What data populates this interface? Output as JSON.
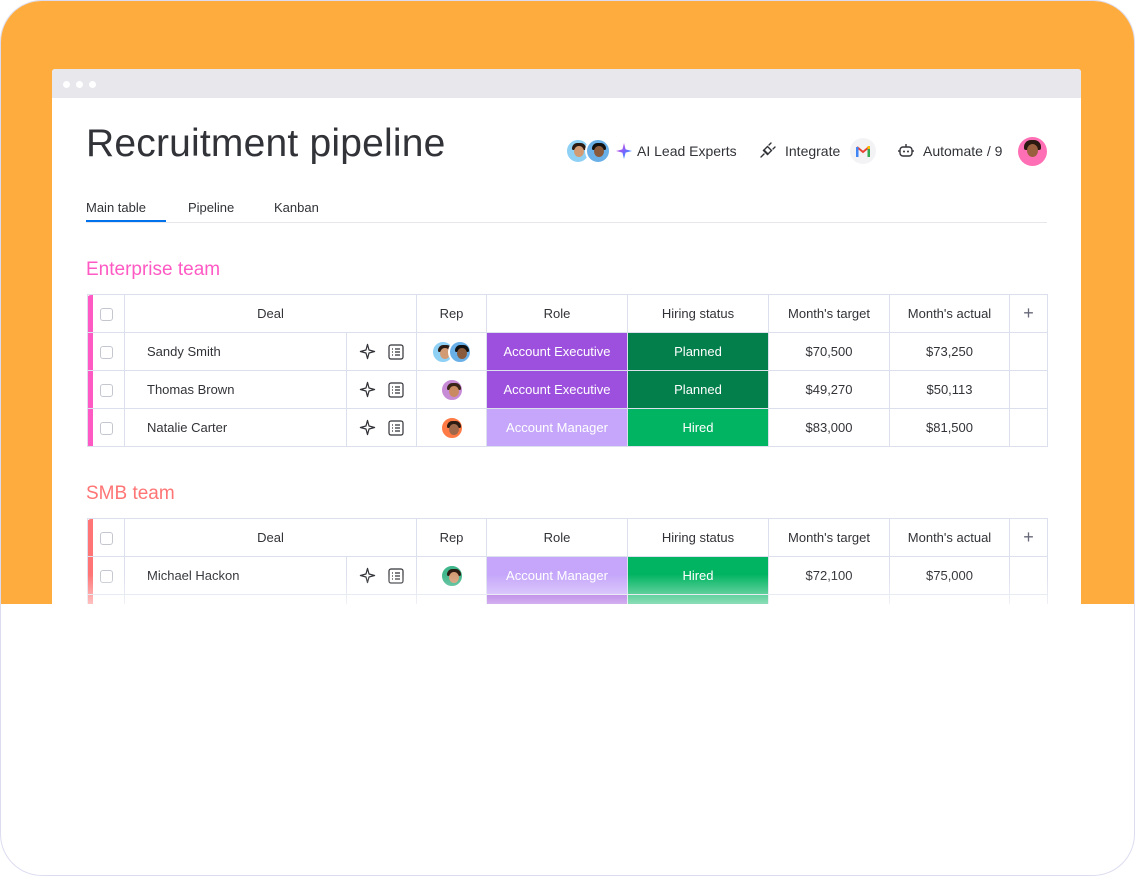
{
  "page": {
    "title": "Recruitment pipeline",
    "colors": {
      "background_accent": "#ffac3f",
      "enterprise_group": "#ff5ac4",
      "smb_group": "#ff7575",
      "account_executive": "#9d50dd",
      "account_manager": "#c5a6fa",
      "planned": "#037f4c",
      "hired": "#00b461",
      "tab_underline": "#0073ea"
    }
  },
  "header": {
    "ai_label": "AI Lead Experts",
    "integrate_label": "Integrate",
    "automate_label": "Automate / 9",
    "icons": [
      "sparkle-icon",
      "plug-icon",
      "gmail-icon",
      "robot-icon"
    ]
  },
  "tabs": [
    {
      "label": "Main table",
      "active": true
    },
    {
      "label": "Pipeline",
      "active": false
    },
    {
      "label": "Kanban",
      "active": false
    }
  ],
  "columns": {
    "deal": "Deal",
    "rep": "Rep",
    "role": "Role",
    "status": "Hiring status",
    "target": "Month's target",
    "actual": "Month's actual",
    "add": "+"
  },
  "groups": [
    {
      "title": "Enterprise team",
      "rows": [
        {
          "name": "Sandy Smith",
          "role": "Account Executive",
          "status": "Planned",
          "target": "$70,500",
          "actual": "$73,250"
        },
        {
          "name": "Thomas Brown",
          "role": "Account Executive",
          "status": "Planned",
          "target": "$49,270",
          "actual": "$50,113"
        },
        {
          "name": "Natalie Carter",
          "role": "Account Manager",
          "status": "Hired",
          "target": "$83,000",
          "actual": "$81,500"
        }
      ]
    },
    {
      "title": "SMB team",
      "rows": [
        {
          "name": "Michael Hackon",
          "role": "Account Manager",
          "status": "Hired",
          "target": "$72,100",
          "actual": "$75,000"
        }
      ]
    }
  ]
}
